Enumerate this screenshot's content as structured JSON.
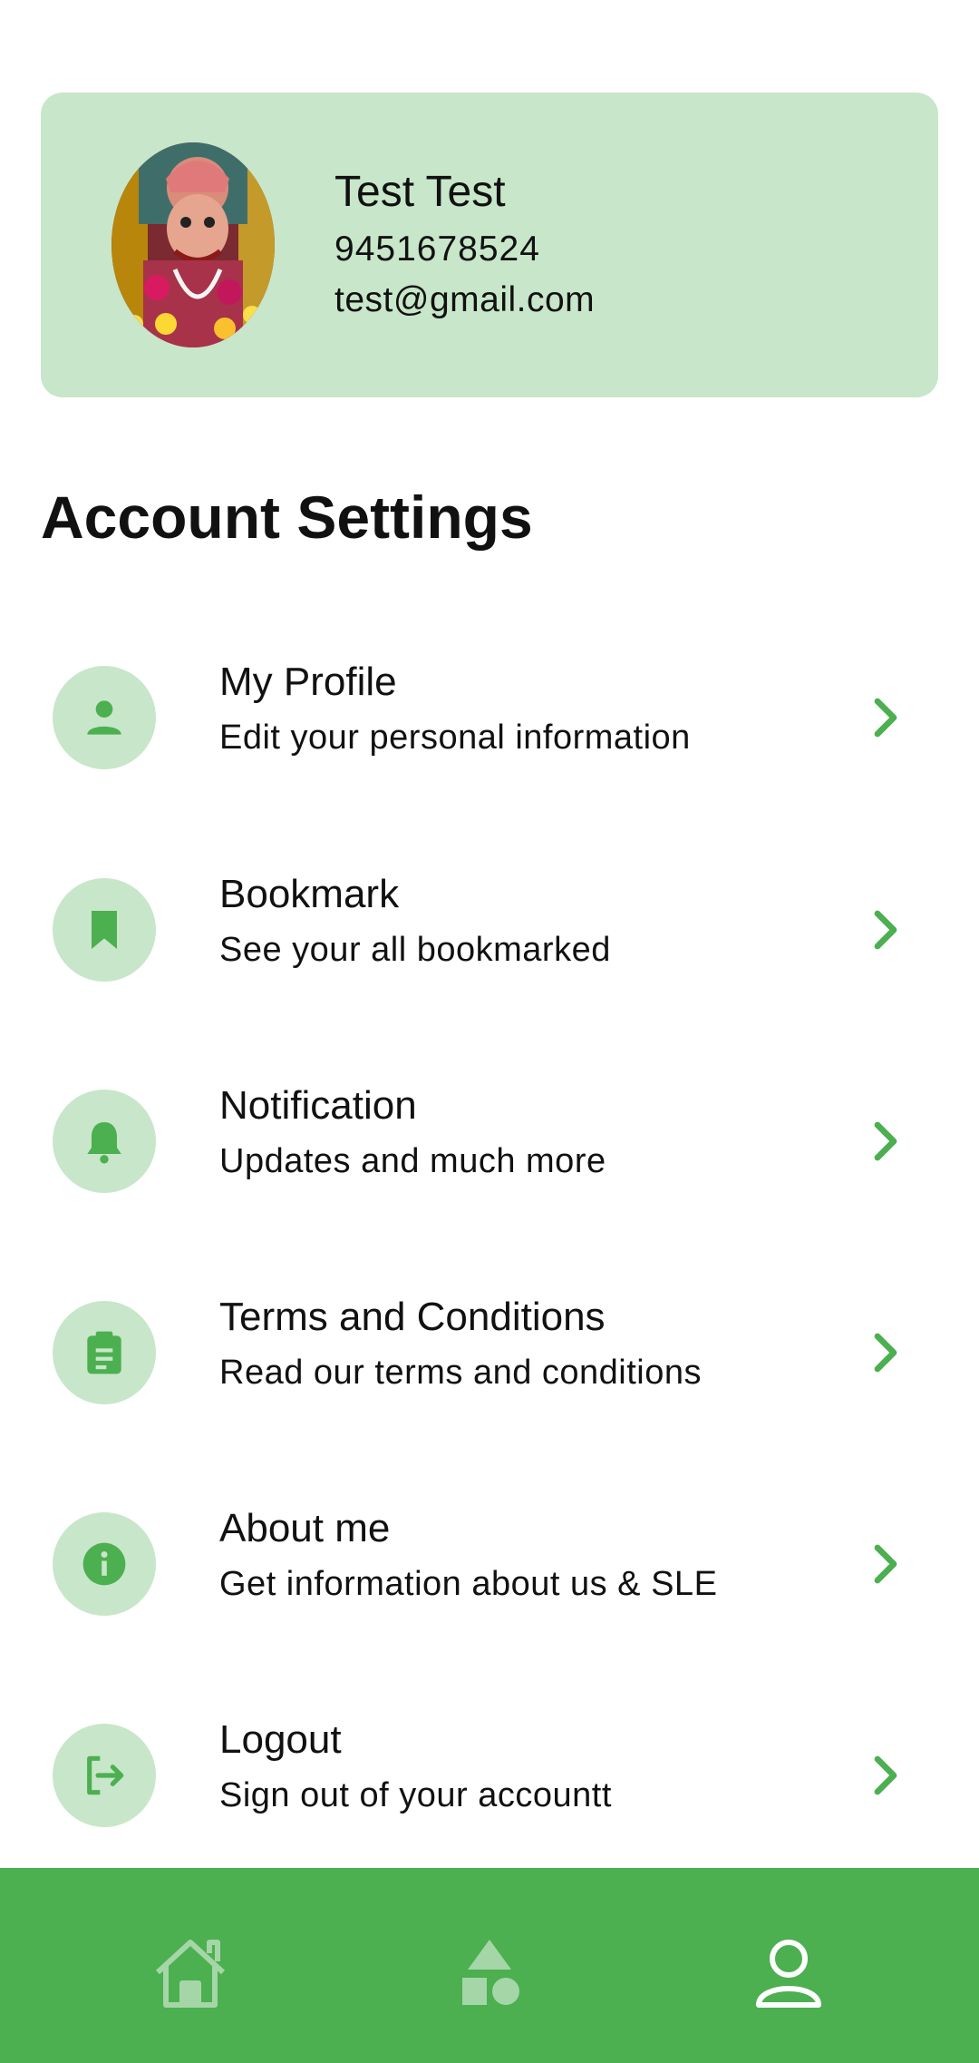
{
  "profile": {
    "name": "Test Test",
    "phone": "9451678524",
    "email": "test@gmail.com",
    "card_color": "#c8e6c9"
  },
  "section_title": "Account Settings",
  "settings": [
    {
      "title": "My Profile",
      "subtitle": "Edit your personal information",
      "icon": "person-icon"
    },
    {
      "title": "Bookmark",
      "subtitle": "See your all bookmarked",
      "icon": "bookmark-icon"
    },
    {
      "title": "Notification",
      "subtitle": "Updates and much more",
      "icon": "bell-icon"
    },
    {
      "title": "Terms and Conditions",
      "subtitle": "Read our terms and conditions",
      "icon": "clipboard-icon"
    },
    {
      "title": "About me",
      "subtitle": "Get information about us & SLE",
      "icon": "info-icon"
    },
    {
      "title": "Logout",
      "subtitle": "Sign out of your accountt",
      "icon": "logout-icon"
    }
  ],
  "bottom_nav": {
    "items": [
      "home-icon",
      "categories-icon",
      "profile-icon"
    ],
    "active": "profile-icon"
  },
  "colors": {
    "accent": "#4caf50",
    "icon_bg": "#c8e6c9",
    "nav_inactive": "#a5d6a7",
    "nav_active": "#ffffff"
  }
}
